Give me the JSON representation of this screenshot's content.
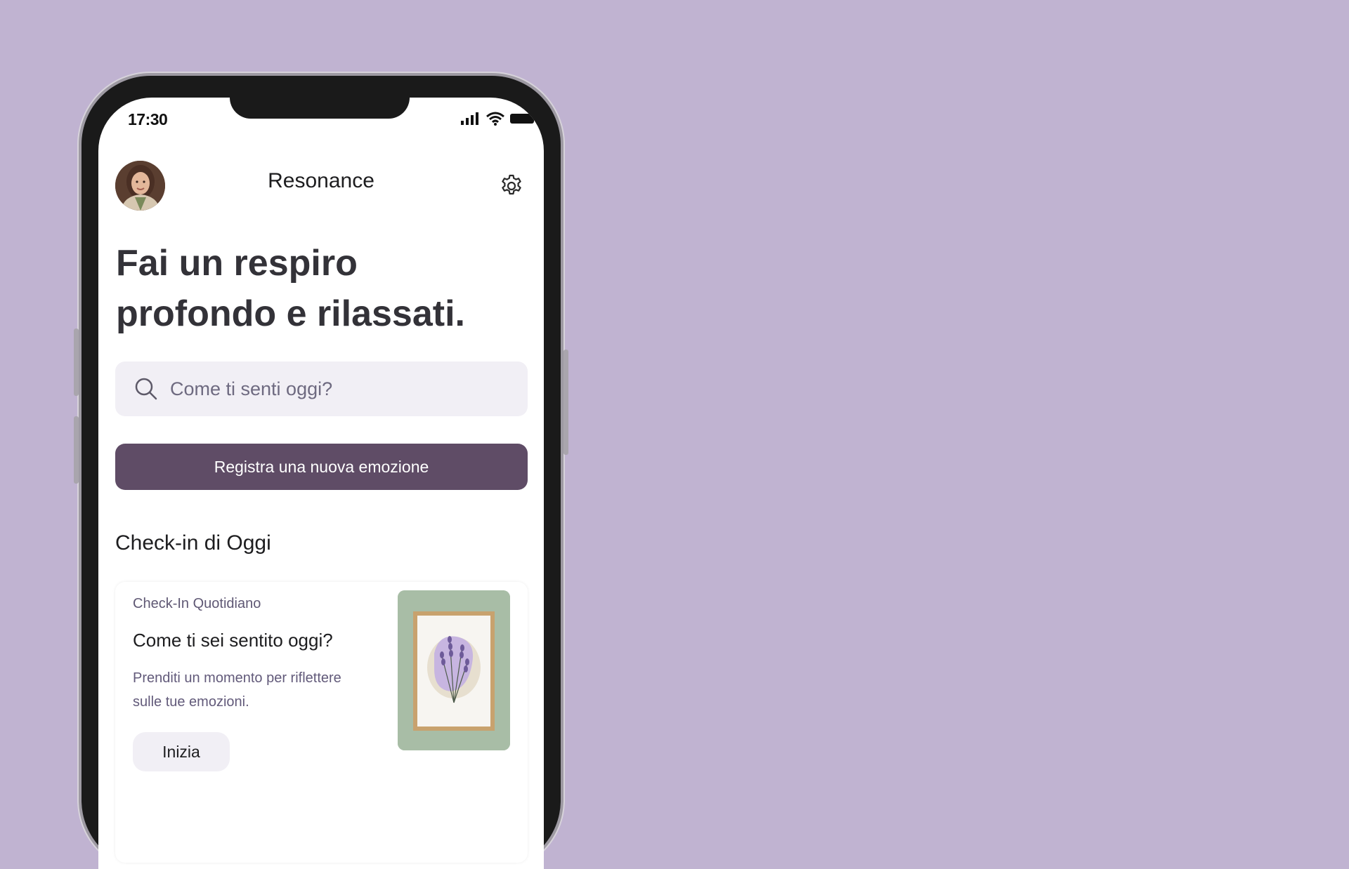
{
  "status": {
    "time": "17:30"
  },
  "header": {
    "title": "Resonance"
  },
  "main": {
    "headline": "Fai un respiro profondo e rilassati.",
    "search_placeholder": "Come ti senti oggi?",
    "cta_label": "Registra una nuova emozione",
    "section_title": "Check-in di Oggi"
  },
  "card": {
    "label": "Check-In Quotidiano",
    "title": "Come ti sei sentito oggi?",
    "description": "Prenditi un momento per riflettere sulle tue emozioni.",
    "button_label": "Inizia"
  },
  "colors": {
    "background": "#c0b3d1",
    "primary": "#5f4c66",
    "surface": "#f1eff5"
  },
  "icons": [
    "signal-icon",
    "wifi-icon",
    "battery-icon",
    "gear-icon",
    "search-icon"
  ]
}
